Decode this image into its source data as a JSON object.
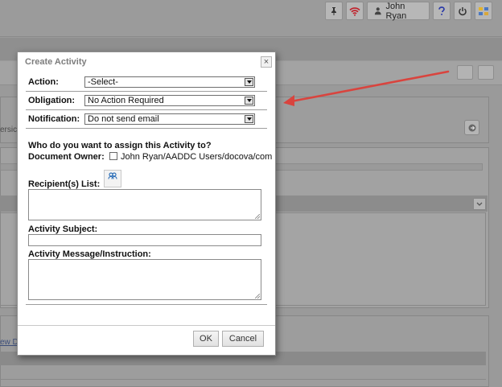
{
  "topbar": {
    "user_name": "John Ryan",
    "icons": [
      "pin-icon",
      "wifi-icon",
      "user-icon",
      "help-icon",
      "power-icon",
      "apps-icon"
    ]
  },
  "background": {
    "left_text_1": "ersic",
    "left_text_2": "ew D"
  },
  "dialog": {
    "title": "Create Activity",
    "close_label": "×",
    "action_label": "Action:",
    "action_value": "-Select-",
    "obligation_label": "Obligation:",
    "obligation_value": "No Action Required",
    "notification_label": "Notification:",
    "notification_value": "Do not send email",
    "assign_question": "Who do you want to assign this Activity to?",
    "doc_owner_label": "Document Owner:",
    "doc_owner_value": "John Ryan/AADDC Users/docova/com",
    "recipients_label": "Recipient(s) List:",
    "subject_label": "Activity Subject:",
    "message_label": "Activity Message/Instruction:",
    "ok_label": "OK",
    "cancel_label": "Cancel"
  },
  "colors": {
    "annotation_arrow": "#d9443e"
  }
}
